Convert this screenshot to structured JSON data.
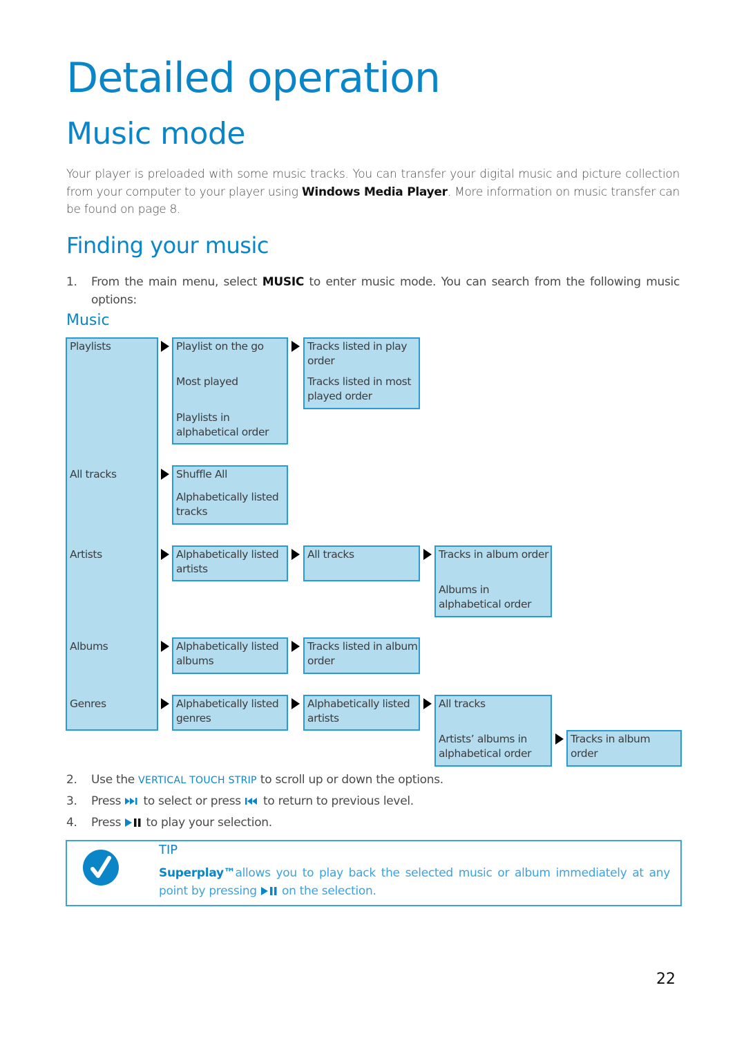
{
  "page": {
    "title": "Detailed operation",
    "section": "Music mode",
    "intro": {
      "before": "Your player is preloaded with some music tracks. You can transfer your digital music and picture collection from your computer to your player using ",
      "bold": "Windows Media Player",
      "after": ". More information on music transfer can be found on page 8."
    },
    "subsection": "Finding your music",
    "step1": {
      "num": "1.",
      "before": "From the main menu, select ",
      "bold": "MUSIC",
      "after": " to enter music mode. You can search from the following music options:"
    },
    "diagram_title": "Music",
    "steps": [
      {
        "num": "2.",
        "before": "Use the ",
        "highlight": "VERTICAL TOUCH STRIP",
        "after": " to scroll up or down the options."
      },
      {
        "num": "3.",
        "before": "Press ",
        "icon1": "next-icon",
        "mid": " to select or press ",
        "icon2": "previous-icon",
        "after": " to return to previous level."
      },
      {
        "num": "4.",
        "before": "Press ",
        "icon1": "play-pause-icon",
        "after": " to play your selection."
      }
    ],
    "tip": {
      "title": "TIP",
      "brand": "Superplay™",
      "before": "allows you to play back the selected music or album immediately at any point by pressing ",
      "icon": "play-pause-icon",
      "after": " on the selection."
    },
    "page_number": "22"
  },
  "menu_tree": {
    "root": [
      "Playlists",
      "All tracks",
      "Artists",
      "Albums",
      "Genres"
    ],
    "playlists": {
      "level2": [
        "Playlist on the go",
        "Most played",
        "Playlists in alphabetical order"
      ],
      "level3": [
        "Tracks listed in play order",
        "Tracks listed in most played order"
      ]
    },
    "all_tracks": {
      "level2": [
        "Shuffle All",
        "Alphabetically listed tracks"
      ]
    },
    "artists": {
      "level2": [
        "Alphabetically listed artists"
      ],
      "level3": [
        "All tracks"
      ],
      "level4": [
        "Tracks in album order",
        "Albums in alphabetical order"
      ]
    },
    "albums": {
      "level2": [
        "Alphabetically listed albums"
      ],
      "level3": [
        "Tracks listed in album order"
      ]
    },
    "genres": {
      "level2": [
        "Alphabetically listed genres"
      ],
      "level3": [
        "Alphabetically listed artists"
      ],
      "level4": [
        "All tracks",
        "Artists’ albums in alphabetical order"
      ],
      "level5": [
        "Tracks in album order"
      ]
    }
  },
  "colors": {
    "accent": "#0a86c8",
    "box_fill": "#b3dcef",
    "box_border": "#2a9ad6",
    "tip_text": "#3aa3de"
  }
}
